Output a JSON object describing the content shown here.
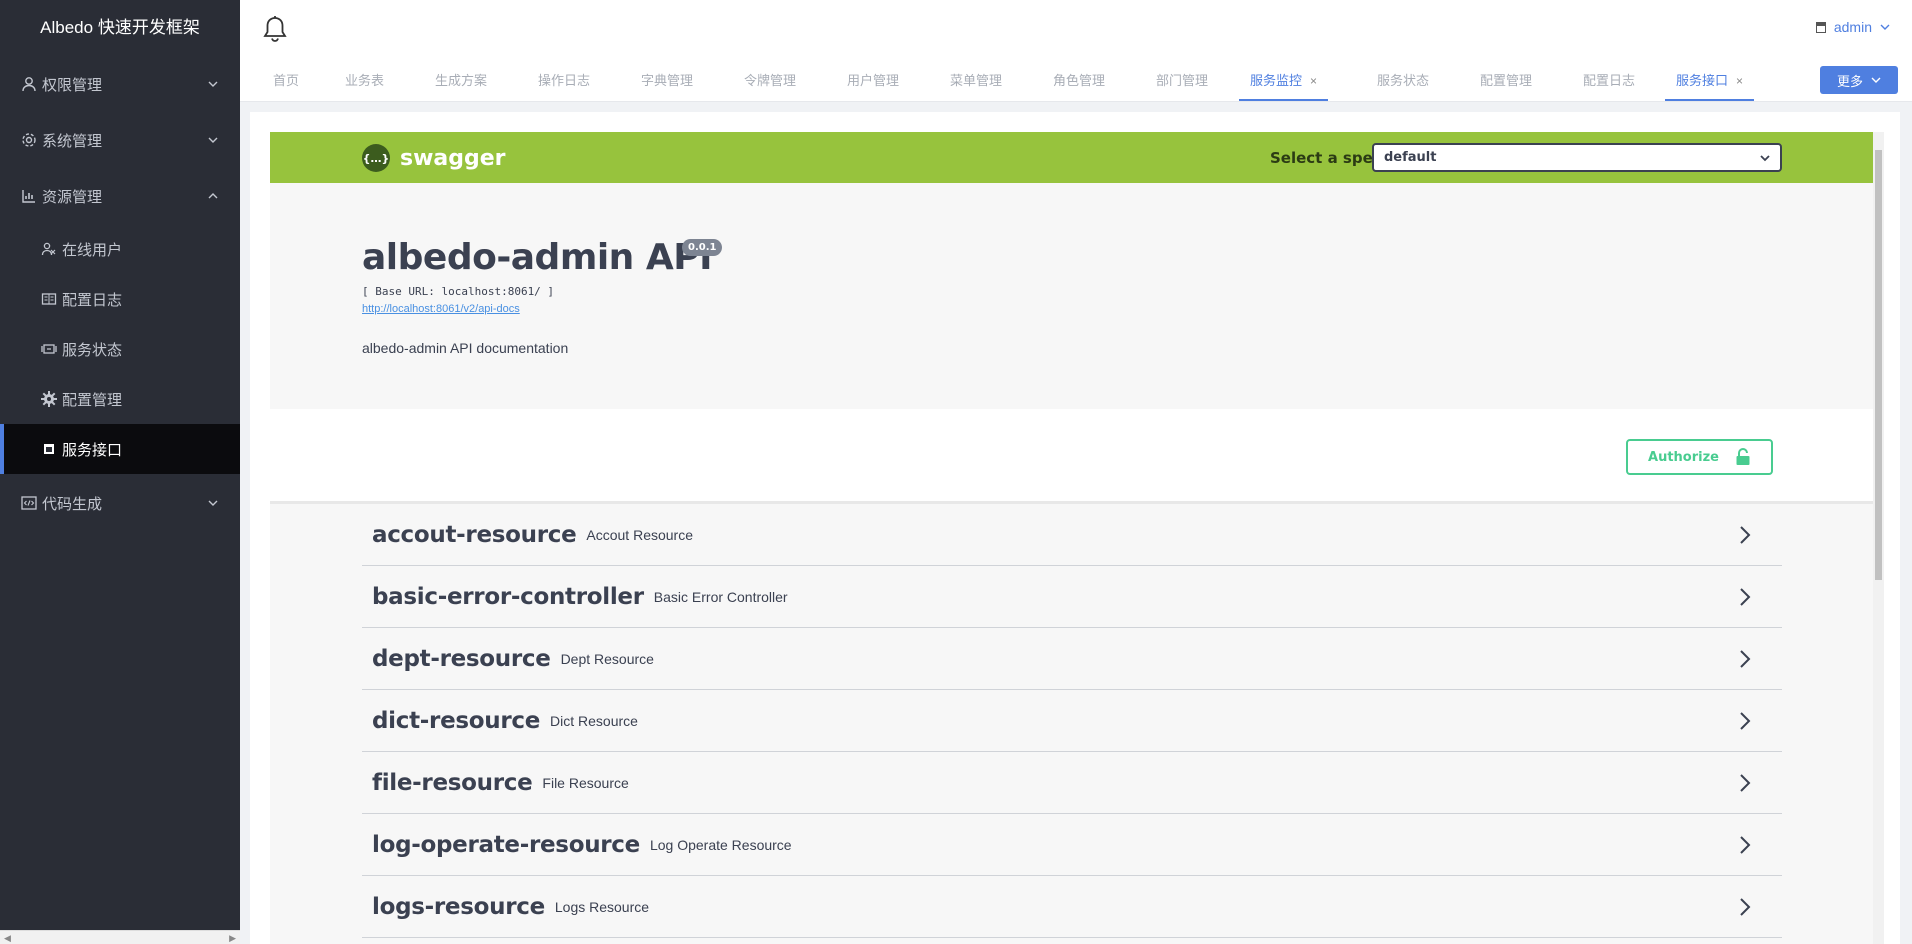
{
  "sidebar": {
    "brand": "Albedo 快速开发框架",
    "items": [
      {
        "label": "权限管理"
      },
      {
        "label": "系统管理"
      },
      {
        "label": "资源管理"
      },
      {
        "label": "在线用户"
      },
      {
        "label": "配置日志"
      },
      {
        "label": "服务状态"
      },
      {
        "label": "配置管理"
      },
      {
        "label": "服务接口"
      },
      {
        "label": "代码生成"
      }
    ]
  },
  "topbar": {
    "user": "admin"
  },
  "tabs": [
    {
      "label": "首页"
    },
    {
      "label": "业务表"
    },
    {
      "label": "生成方案"
    },
    {
      "label": "操作日志"
    },
    {
      "label": "字典管理"
    },
    {
      "label": "令牌管理"
    },
    {
      "label": "用户管理"
    },
    {
      "label": "菜单管理"
    },
    {
      "label": "角色管理"
    },
    {
      "label": "部门管理"
    },
    {
      "label": "服务监控",
      "close": "×"
    },
    {
      "label": "服务状态"
    },
    {
      "label": "配置管理"
    },
    {
      "label": "配置日志"
    },
    {
      "label": "服务接口",
      "close": "×"
    }
  ],
  "more_label": "更多",
  "swagger": {
    "logo_symbol": "{…}",
    "logo_text": "swagger",
    "spec_label": "Select a spec",
    "spec_value": "default",
    "title": "albedo-admin API",
    "version": "0.0.1",
    "base_url": "[ Base URL: localhost:8061/ ]",
    "docs_link": "http://localhost:8061/v2/api-docs",
    "description": "albedo-admin API documentation",
    "authorize_label": "Authorize",
    "tags": [
      {
        "name": "accout-resource",
        "desc": "Accout Resource"
      },
      {
        "name": "basic-error-controller",
        "desc": "Basic Error Controller"
      },
      {
        "name": "dept-resource",
        "desc": "Dept Resource"
      },
      {
        "name": "dict-resource",
        "desc": "Dict Resource"
      },
      {
        "name": "file-resource",
        "desc": "File Resource"
      },
      {
        "name": "log-operate-resource",
        "desc": "Log Operate Resource"
      },
      {
        "name": "logs-resource",
        "desc": "Logs Resource"
      }
    ]
  },
  "colors": {
    "sidebar_bg": "#2a2d36",
    "accent": "#4f7fe0",
    "swagger_green": "#97c33d",
    "authorize_green": "#49cc90"
  }
}
